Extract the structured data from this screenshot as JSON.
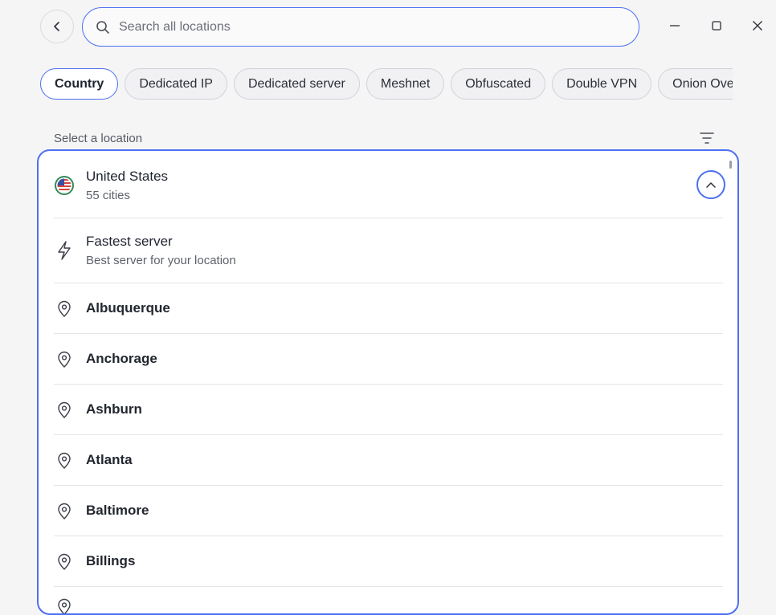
{
  "header": {
    "search_placeholder": "Search all locations"
  },
  "chips": [
    {
      "label": "Country",
      "active": true
    },
    {
      "label": "Dedicated IP"
    },
    {
      "label": "Dedicated server"
    },
    {
      "label": "Meshnet"
    },
    {
      "label": "Obfuscated"
    },
    {
      "label": "Double VPN"
    },
    {
      "label": "Onion Over VPN"
    }
  ],
  "section_label": "Select a location",
  "country": {
    "name": "United States",
    "cities_count": "55 cities",
    "flag_icon": "us-flag-icon"
  },
  "fastest": {
    "title": "Fastest server",
    "subtitle": "Best server for your location"
  },
  "cities": [
    "Albuquerque",
    "Anchorage",
    "Ashburn",
    "Atlanta",
    "Baltimore",
    "Billings"
  ],
  "colors": {
    "accent": "#4d6ff2",
    "background": "#f5f5f6",
    "panel": "#ffffff"
  }
}
